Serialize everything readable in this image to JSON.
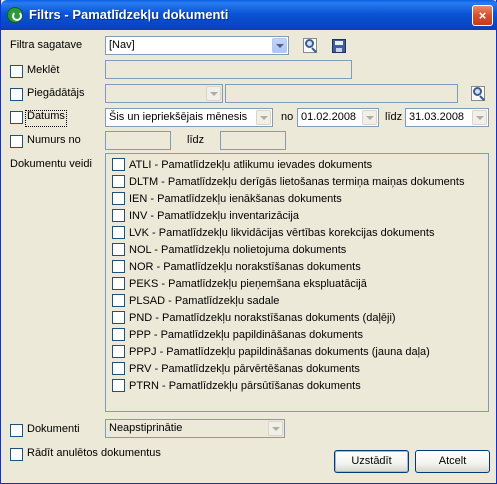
{
  "window": {
    "title": "Filtrs - Pamatlīdzekļu dokumenti",
    "close_label": "×"
  },
  "template": {
    "label": "Filtra sagatave",
    "value": "[Nav]"
  },
  "search": {
    "label": "Meklēt",
    "value": ""
  },
  "supplier": {
    "label": "Piegādātājs",
    "value": ""
  },
  "date": {
    "label": "Datums",
    "period": "Šis un iepriekšējais mēnesis",
    "from_label": "no",
    "from_value": "01.02.2008",
    "to_label": "līdz",
    "to_value": "31.03.2008"
  },
  "number": {
    "label": "Numurs no",
    "to_label": "līdz",
    "from_value": "",
    "to_value": ""
  },
  "doc_types": {
    "label": "Dokumentu veidi",
    "items": [
      {
        "code": "ATLI",
        "text": "ATLI - Pamatlīdzekļu atlikumu ievades dokuments"
      },
      {
        "code": "DLTM",
        "text": "DLTM - Pamatlīdzekļu derīgās lietošanas termiņa maiņas dokuments"
      },
      {
        "code": "IEN",
        "text": "IEN - Pamatlīdzekļu ienākšanas dokuments"
      },
      {
        "code": "INV",
        "text": "INV - Pamatlīdzekļu inventarizācija"
      },
      {
        "code": "LVK",
        "text": "LVK - Pamatlīdzekļu likvidācijas vērtības korekcijas dokuments"
      },
      {
        "code": "NOL",
        "text": "NOL - Pamatlīdzekļu nolietojuma dokuments"
      },
      {
        "code": "NOR",
        "text": "NOR - Pamatlīdzekļu norakstīšanas dokuments"
      },
      {
        "code": "PEKS",
        "text": "PEKS - Pamatlīdzekļu pieņemšana ekspluatācijā"
      },
      {
        "code": "PLSAD",
        "text": "PLSAD - Pamatlīdzekļu sadale"
      },
      {
        "code": "PND",
        "text": "PND - Pamatlīdzekļu norakstīšanas dokuments (daļēji)"
      },
      {
        "code": "PPP",
        "text": "PPP - Pamatlīdzekļu papildināšanas dokuments"
      },
      {
        "code": "PPPJ",
        "text": "PPPJ - Pamatlīdzekļu papildināšanas dokuments (jauna daļa)"
      },
      {
        "code": "PRV",
        "text": "PRV - Pamatlīdzekļu pārvērtēšanas dokuments"
      },
      {
        "code": "PTRN",
        "text": "PTRN - Pamatlīdzekļu pārsūtīšanas dokuments"
      }
    ]
  },
  "documents": {
    "label": "Dokumenti",
    "value": "Neapstiprinātie"
  },
  "show_cancelled": {
    "label": "Rādīt anulētos dokumentus"
  },
  "buttons": {
    "apply": "Uzstādīt",
    "cancel": "Atcelt"
  },
  "icons": {
    "title": "app-icon",
    "search": "search-icon",
    "save": "save-icon"
  }
}
